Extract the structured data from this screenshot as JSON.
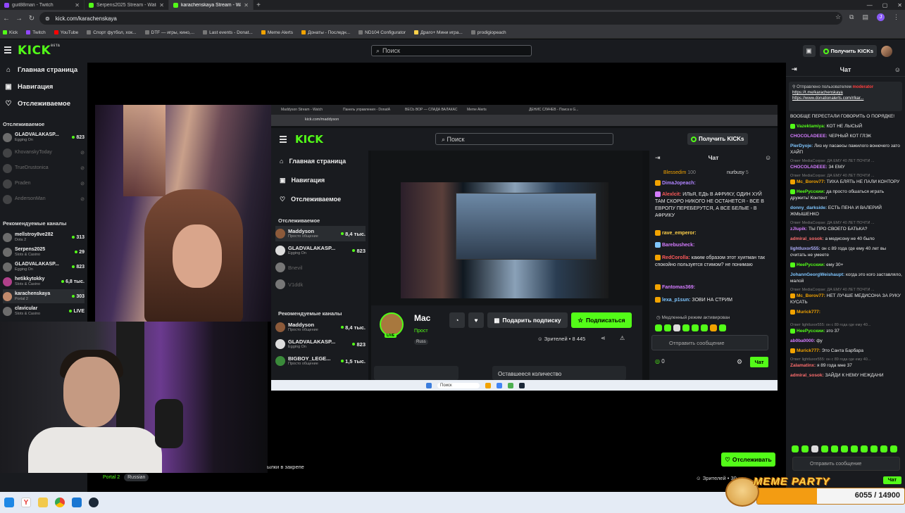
{
  "browser": {
    "tabs": [
      {
        "label": "guit88man - Twitch",
        "favicon": "twitch-icon"
      },
      {
        "label": "Serpens2025 Stream - Watch L",
        "favicon": "kick-icon"
      },
      {
        "label": "karachenskaya Stream - Watch",
        "favicon": "kick-icon",
        "active": true
      }
    ],
    "url": "kick.com/karachenskaya",
    "profile_initial": "J",
    "bookmarks": [
      "Kick",
      "Twitch",
      "YouTube",
      "Спорт футбол, хок...",
      "DTF — игры, кино,...",
      "Last events - Donat...",
      "Meme Alerts",
      "Донаты - Последн...",
      "ND104 Configurator",
      "Драго+ Мини игра...",
      "prodigiopeach"
    ]
  },
  "header": {
    "logo": "KICK",
    "logo_sup": "BETA",
    "search_placeholder": "Поиск",
    "get_kicks": "Получить KICKs"
  },
  "sidebar": {
    "nav": [
      {
        "label": "Главная страница",
        "icon": "home-icon"
      },
      {
        "label": "Навигация",
        "icon": "compass-icon"
      },
      {
        "label": "Отслеживаемое",
        "icon": "heart-icon"
      }
    ],
    "followed_title": "Отслеживаемое",
    "followed": [
      {
        "name": "GLADVALAKASP...",
        "sub": "Egging On",
        "viewers": "823",
        "live": true
      },
      {
        "name": "KhovanskyToday",
        "sub": "",
        "viewers": "",
        "live": false
      },
      {
        "name": "TrueDrustonica",
        "sub": "",
        "viewers": "",
        "live": false
      },
      {
        "name": "Praden",
        "sub": "",
        "viewers": "",
        "live": false
      },
      {
        "name": "AndersonMan",
        "sub": "",
        "viewers": "",
        "live": false
      }
    ],
    "recommended_title": "Рекомендуемые каналы",
    "recommended": [
      {
        "name": "mellstroy8ve282",
        "sub": "Dota 2",
        "viewers": "313"
      },
      {
        "name": "Serpens2025",
        "sub": "Slots & Casino",
        "viewers": "29"
      },
      {
        "name": "GLADVALAKASP...",
        "sub": "Egging On",
        "viewers": "823"
      },
      {
        "name": "hetikkytokky",
        "sub": "Slots & Casino",
        "viewers": "6,8 тыс."
      },
      {
        "name": "karachenskaya",
        "sub": "Portal 2",
        "viewers": "303",
        "selected": true
      },
      {
        "name": "clavicular",
        "sub": "Slots & Casino",
        "viewers": "LIVE"
      }
    ]
  },
  "capture": {
    "tabs": [
      "Maddyson Stream - Watch",
      "Панель управления - DonatA",
      "ВЕСЬ ВОР — СЛАДА ВАЛАКАС",
      "Meme Alerts",
      "ДЕНИС СЛАЧЕВ - Поиск в G..."
    ],
    "url": "kick.com/maddyson",
    "logo": "KICK",
    "search_placeholder": "Поиск",
    "get_kicks": "Получить KICKs",
    "nav": [
      "Главная страница",
      "Навигация",
      "Отслеживаемое"
    ],
    "followed_title": "Отслеживаемое",
    "followed": [
      {
        "name": "Maddyson",
        "sub": "Просто общение",
        "viewers": "8,4 тыс.",
        "selected": true
      },
      {
        "name": "GLADVALAKASP...",
        "sub": "Egging On",
        "viewers": "823"
      },
      {
        "name": "Bnevil",
        "sub": "",
        "viewers": "",
        "off": true
      },
      {
        "name": "V1ddk",
        "sub": "",
        "viewers": "",
        "off": true
      }
    ],
    "recommended_title": "Рекомендуемые каналы",
    "recommended": [
      {
        "name": "Maddyson",
        "sub": "Просто общение",
        "viewers": "8,4 тыс."
      },
      {
        "name": "GLADVALAKASP...",
        "sub": "Egging On",
        "viewers": "823"
      },
      {
        "name": "BIGBOY_LEGE...",
        "sub": "Просто общение",
        "viewers": "1,5 тыс."
      }
    ],
    "streamer_short": "Mac",
    "live_badge": "LIVE",
    "gift_sub": "Подарить подписку",
    "subscribe": "Подписаться",
    "viewers_label": "Зрителей • 8 445",
    "tag_short": "Прост",
    "lang_short": "Russ",
    "remaining": "Оставшееся количество",
    "chat_title": "Чат",
    "top_gifters": [
      {
        "name": "Blessedim",
        "n": "100"
      },
      {
        "name": "nurbusy",
        "n": "5"
      }
    ],
    "messages": [
      {
        "user": "DimaJopeach:",
        "text": ""
      },
      {
        "user": "Alexlcit:",
        "text": "ИЛЬЯ, ЕДЬ В АФРИКУ, ОДИН ХУЙ ТАМ СКОРО НИКОГО НЕ ОСТАНЕТСЯ - ВСЕ В ЕВРОПУ ПЕРЕБЕРУТСЯ, А ВСЕ БЕЛЫЕ - В АФРИКУ"
      },
      {
        "user": "rave_emperor:",
        "text": ""
      },
      {
        "user": "Barebusheck:",
        "text": ""
      },
      {
        "user": "RedCorolla:",
        "text": "каким образом этот хуитман так спокойно пользуется стимом? не понимаю"
      },
      {
        "user": "Fantomas369:",
        "text": ""
      },
      {
        "user": "lexa_p1sun:",
        "text": "ЗОВИ НА СТРИМ"
      }
    ],
    "slow_mode": "Медленный режим активирован",
    "send_placeholder": "Отправить сообщение",
    "kicks_count": "0",
    "chat_btn": "Чат",
    "taskbar_search": "Поиск"
  },
  "below": {
    "pinned_text": "ылки в закрепе",
    "category": "Portal 2",
    "language": "Russian",
    "follow": "Отслеживать",
    "viewers": "Зрителей • 30"
  },
  "chat": {
    "title": "Чат",
    "pinned_by_label": "Отправлено пользователем",
    "pinned_by_user": "moderator",
    "pinned_links": [
      "https://t.me/karachenskaya",
      "https://www.donationalerts.com/r/kar..."
    ],
    "messages": [
      {
        "reply": "",
        "user": "",
        "text": "ВООБЩЕ ПЕРЕСТАЛИ ГОВОРИТЬ О ПОРЯДКЕ!",
        "color": "#ffffff",
        "badge": ""
      },
      {
        "reply": "",
        "user": "Vazektamiya:",
        "text": "КОТ НЕ ЛЫСЫЙ",
        "color": "#53fc18",
        "badge": "g"
      },
      {
        "reply": "",
        "user": "CHOCOLADEEE:",
        "text": "ЧЕРНЫЙ КОТ ГЛЭК",
        "color": "#d47cff",
        "badge": ""
      },
      {
        "reply": "",
        "user": "PierDyoje:",
        "text": "Лиз ну пасаесы пажилого вонючего зато ХАЙП",
        "color": "#7fc6ff",
        "badge": ""
      },
      {
        "reply": "Ответ MediaCorpse: ДА ЕМУ 40 ЛЕТ ПОЧТИ ...",
        "user": "CHOCOLADEEE:",
        "text": "34 ЕМУ",
        "color": "#d47cff",
        "badge": ""
      },
      {
        "reply": "Ответ MediaCorpse: ДА ЕМУ 40 ЛЕТ ПОЧТИ ...",
        "user": "Mc_Borov77:",
        "text": "ТИХА БЛЯТЬ НЕ ПАЛИ КОНТОРУ",
        "color": "#f2a300",
        "badge": "y"
      },
      {
        "reply": "",
        "user": "HeeРусскии:",
        "text": "да просто обшаться играть дружить! Контент",
        "color": "#53fc18",
        "badge": "g"
      },
      {
        "reply": "",
        "user": "donny_darkside:",
        "text": "ЕСТЬ ПЕНА И ВАЛЕРИЙ ЖМЫШЕНКО",
        "color": "#7fc6ff",
        "badge": ""
      },
      {
        "reply": "Ответ MediaCorpse: ДА ЕМУ 40 ЛЕТ ПОЧТИ ...",
        "user": "zJlupik:",
        "text": "ТЫ ПРО СВОЕГО БАТЬКА?",
        "color": "#d47cff",
        "badge": ""
      },
      {
        "reply": "",
        "user": "admiral_sosok:",
        "text": "а медисону не 40 было",
        "color": "#ff6e6e",
        "badge": ""
      },
      {
        "reply": "",
        "user": "lightluxor555:",
        "text": "он с 89 года где ему 40 лет вы считать не умеете",
        "color": "#b0b0ff",
        "badge": ""
      },
      {
        "reply": "",
        "user": "HeeРусскии:",
        "text": "ему 30+",
        "color": "#53fc18",
        "badge": "g"
      },
      {
        "reply": "",
        "user": "JohannGeorgWeishaupt:",
        "text": "когда это кого заставляло, малой",
        "color": "#7fc6ff",
        "badge": ""
      },
      {
        "reply": "Ответ MediaCorpse: ДА ЕМУ 40 ЛЕТ ПОЧТИ ...",
        "user": "Mc_Borov77:",
        "text": "НЕТ ЛУЧШЕ МЕДИСОНА ЗА РУКУ КУСАТЬ",
        "color": "#f2a300",
        "badge": "y"
      },
      {
        "reply": "",
        "user": "Murick777:",
        "text": "",
        "color": "#f2a300",
        "badge": "y"
      },
      {
        "reply": "Ответ lightluxor555: он с 89 года где ему 40...",
        "user": "HeeРусскии:",
        "text": "это 37",
        "color": "#53fc18",
        "badge": "g"
      },
      {
        "reply": "",
        "user": "ab0ba0000:",
        "text": "фу",
        "color": "#d47cff",
        "badge": ""
      },
      {
        "reply": "",
        "user": "Murick777:",
        "text": "Это Санта Барбара",
        "color": "#f2a300",
        "badge": "y"
      },
      {
        "reply": "Ответ lightluxor555: он с 89 года где ему 40...",
        "user": "Zalamatinx:",
        "text": "я 89 года мне 37",
        "color": "#ff6e6e",
        "badge": ""
      },
      {
        "reply": "",
        "user": "admiral_sosok:",
        "text": "ЗАЙДИ К НЕМУ НЕЖДАНИ",
        "color": "#ff6e6e",
        "badge": ""
      }
    ],
    "send_placeholder": "Отправить сообщение",
    "send_btn": "Чат"
  },
  "overlay": {
    "title": "MEME PARTY",
    "progress_text": "6055 / 14900",
    "progress_fraction": 0.406
  }
}
